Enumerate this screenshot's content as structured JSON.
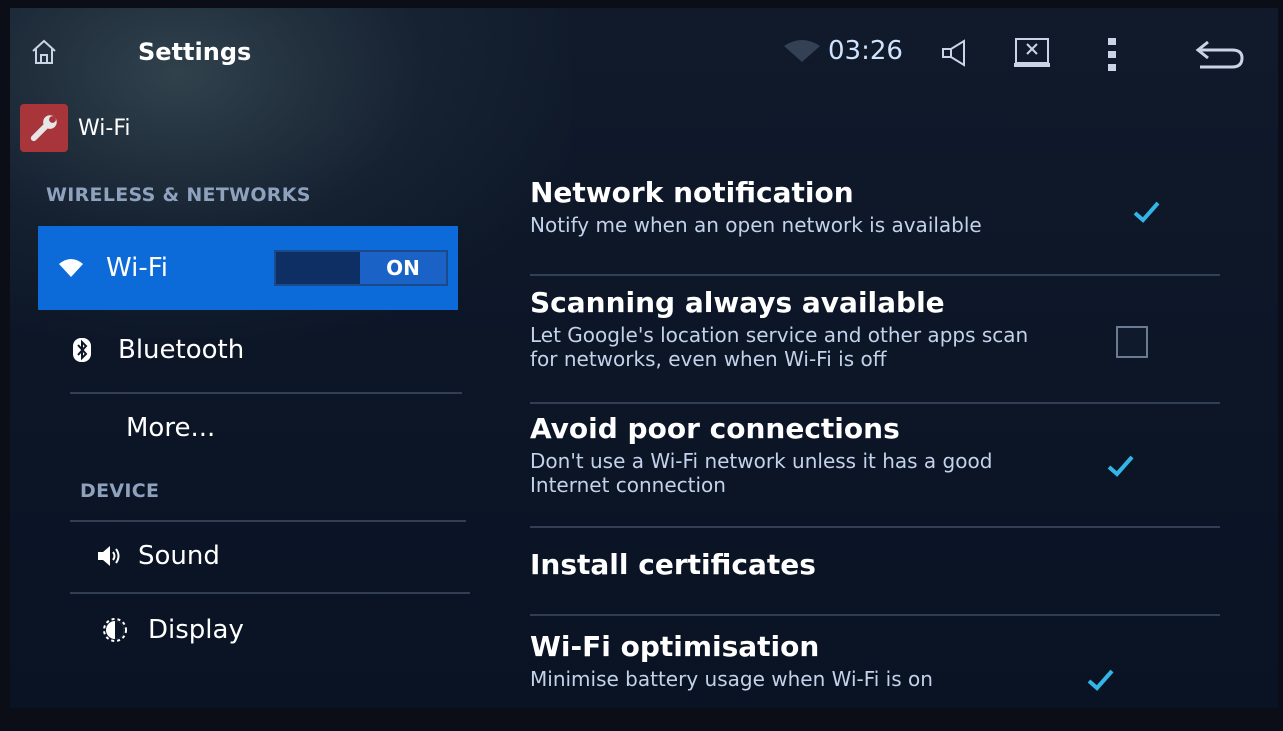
{
  "status_bar": {
    "title": "Settings",
    "time": "03:26",
    "icons": [
      "home-icon",
      "wifi-signal-icon",
      "volume-icon",
      "screenshot-icon",
      "overflow-menu-icon",
      "back-icon"
    ]
  },
  "breadcrumb": {
    "label": "Wi-Fi",
    "icon": "settings-wrench-icon"
  },
  "left_panel": {
    "wireless_header": "WIRELESS & NETWORKS",
    "device_header": "DEVICE",
    "items": [
      {
        "label": "Wi-Fi",
        "icon": "wifi-icon",
        "selected": true,
        "toggle": "ON"
      },
      {
        "label": "Bluetooth",
        "icon": "bluetooth-icon"
      },
      {
        "label": "More..."
      },
      {
        "label": "Sound",
        "icon": "sound-icon"
      },
      {
        "label": "Display",
        "icon": "display-icon"
      }
    ]
  },
  "preferences": [
    {
      "title": "Network notification",
      "summary": "Notify me when an open network is available",
      "checked": true
    },
    {
      "title": "Scanning always available",
      "summary": "Let Google's location service and other apps scan for networks, even when Wi-Fi is off",
      "checked": false
    },
    {
      "title": "Avoid poor connections",
      "summary": "Don't use a Wi-Fi network unless it has a good Internet connection",
      "checked": true
    },
    {
      "title": "Install certificates",
      "summary": ""
    },
    {
      "title": "Wi-Fi optimisation",
      "summary": "Minimise battery usage when Wi-Fi is on",
      "checked": true
    }
  ],
  "colors": {
    "accent": "#0d6bd9",
    "check": "#33b5e5",
    "background": "#0c1627"
  }
}
